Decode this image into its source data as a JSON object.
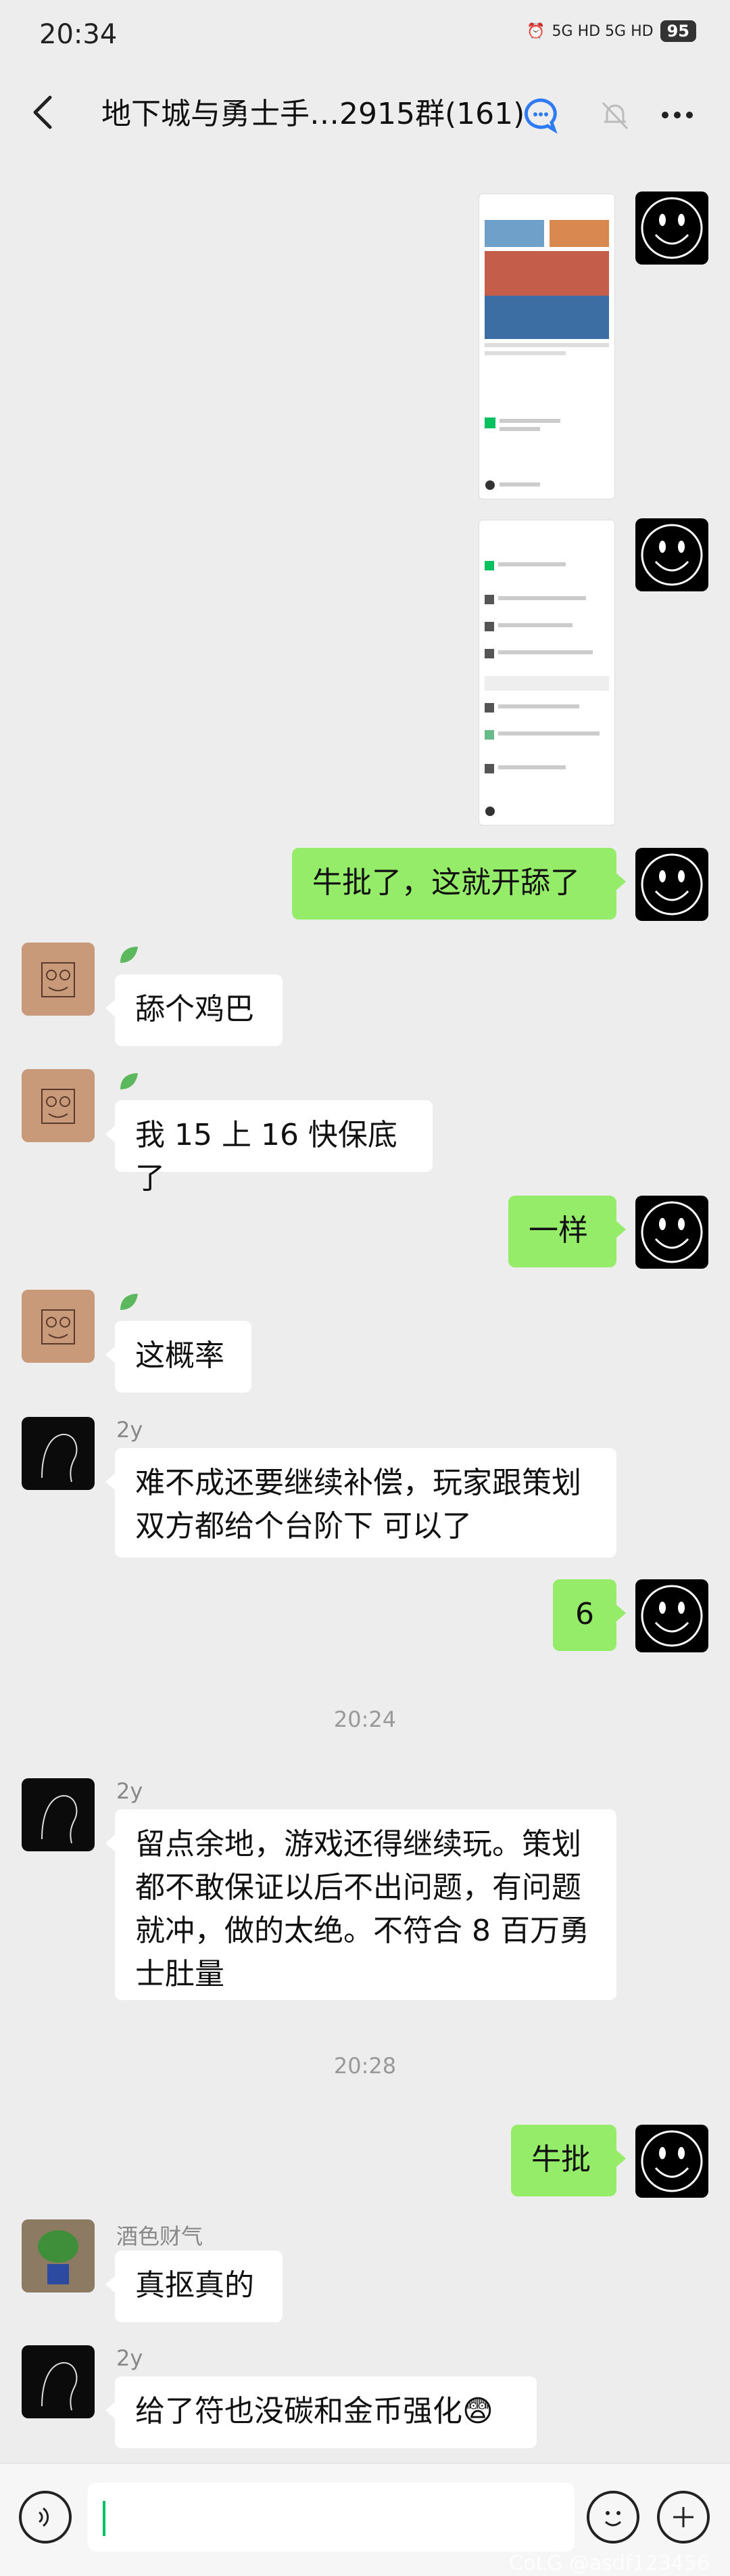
{
  "status_bar": {
    "time": "20:34",
    "network": "5G HD 5G HD",
    "battery": "95"
  },
  "header": {
    "title": "地下城与勇士手…2915群(161)"
  },
  "messages": {
    "m3": "牛批了，这就开舔了",
    "m4": "舔个鸡巴",
    "m5": "我 15 上 16 快保底了",
    "m6": "一样",
    "m7": "这概率",
    "m8_line1": "难不成还要继续补偿，玩家跟策划",
    "m8_line2": "双方都给个台阶下  可以了",
    "m9": "6",
    "m10_line1": "留点余地，游戏还得继续玩。策划",
    "m10_line2": "都不敢保证以后不出问题，有问题",
    "m10_line3": "就冲，做的太绝。不符合 8 百万勇",
    "m10_line4": "士肚量",
    "m11": "牛批",
    "m12": "真抠真的",
    "m13": "给了符也没碳和金币强化😨"
  },
  "nicknames": {
    "dark1": "2y",
    "dark2": "2y",
    "dark3": "2y",
    "plant": "酒色财气"
  },
  "timestamps": {
    "t1": "20:24",
    "t2": "20:28"
  },
  "watermark": "CoLG @asdf123456",
  "colors": {
    "bubble_green": "#95ec69",
    "background": "#ededed",
    "caret": "#07c160"
  }
}
